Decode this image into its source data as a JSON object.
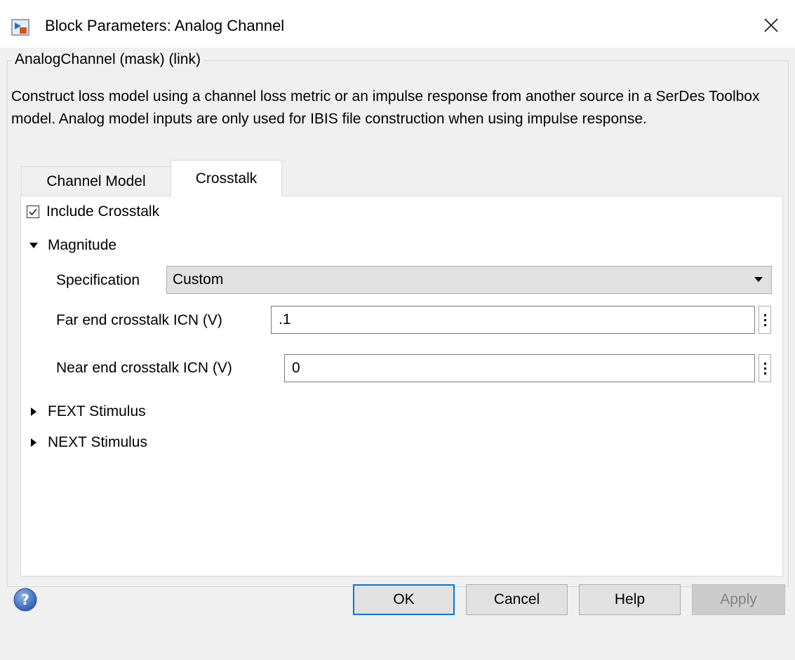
{
  "window": {
    "title": "Block Parameters: Analog Channel",
    "icon": "simulink-block-icon",
    "close_icon": "close-icon"
  },
  "group": {
    "legend": "AnalogChannel (mask) (link)",
    "description": "Construct loss model using a channel loss metric or an impulse response from another source in a SerDes Toolbox model.  Analog model inputs are only used for IBIS file construction when using impulse response."
  },
  "tabs": [
    {
      "label": "Channel Model",
      "active": false
    },
    {
      "label": "Crosstalk",
      "active": true
    }
  ],
  "crosstalk": {
    "include_label": "Include Crosstalk",
    "include_checked": true,
    "magnitude_label": "Magnitude",
    "magnitude_expanded": true,
    "specification_label": "Specification",
    "specification_value": "Custom",
    "fext_icn_label": "Far end crosstalk ICN (V)",
    "fext_icn_value": ".1",
    "next_icn_label": "Near end crosstalk ICN (V)",
    "next_icn_value": "0",
    "fext_stimulus_label": "FEXT Stimulus",
    "next_stimulus_label": "NEXT Stimulus"
  },
  "buttons": {
    "ok": "OK",
    "cancel": "Cancel",
    "help": "Help",
    "apply": "Apply",
    "apply_enabled": false
  },
  "colors": {
    "dialog_bg": "#f0f0f0",
    "default_button_border": "#0078d7",
    "help_icon": "#3a6fc4"
  }
}
